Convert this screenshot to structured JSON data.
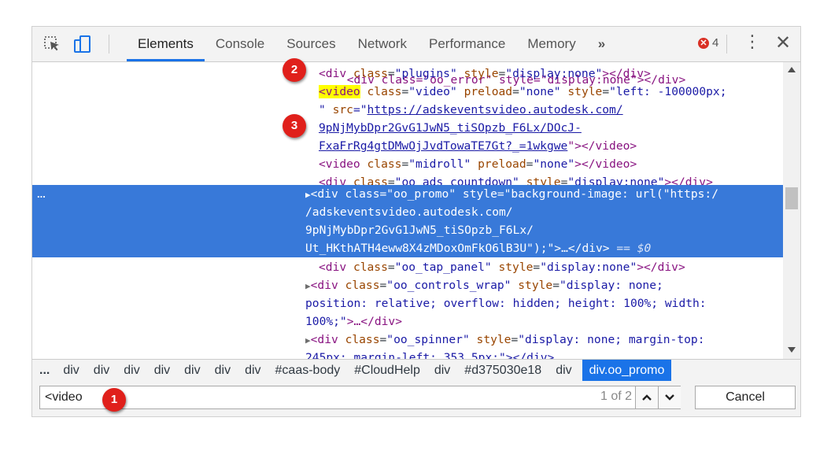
{
  "toolbar": {
    "tabs": [
      "Elements",
      "Console",
      "Sources",
      "Network",
      "Performance",
      "Memory"
    ],
    "more_icon": "»",
    "error_count": "4",
    "kebab": "⋮",
    "close": "✕"
  },
  "tree": {
    "l0": "<div class=\"oo_error\" style=\"display:none\"></div>",
    "l1_open": "<div ",
    "l1_attr": "class",
    "l1_val": "\"plugins\"",
    "l1_attr2": "style",
    "l1_val2": "\"display:none\"",
    "l1_close": "></div>",
    "l2_tag": "<video",
    "l2_rest_attr": "class",
    "l2_rest_val": "\"video\"",
    "l2_attr2": "preload",
    "l2_val2": "\"none\"",
    "l2_attr3": "style",
    "l2_val3": "\"left: -100000px;",
    "l3_q": "\"",
    "l3_attr": "src",
    "l3_eq": "=\"",
    "l3_link": "https://adskeventsvideo.autodesk.com/",
    "l4_link": "9pNjMybDpr2GvG1JwN5_tiSOpzb_F6Lx/DOcJ-",
    "l5_link": "FxaFrRg4gtDMwOjJvdTowaTE7Gt?_=1wkgwe",
    "l5_end": "\"></video>",
    "l6_attr": "class",
    "l6_val": "\"midroll\"",
    "l6_attr2": "preload",
    "l6_val2": "\"none\"",
    "l6_close": "></video>",
    "l7_attr": "class",
    "l7_val": "\"oo_ads_countdown\"",
    "l7_attr2": "style",
    "l7_val2": "\"display:none\"",
    "l7_close": "></div>",
    "sel_dots": "...",
    "sel1": "<div class=\"oo_promo\" style=\"background-image: url(\"https:/",
    "sel2": "/adskeventsvideo.autodesk.com/",
    "sel3": "9pNjMybDpr2GvG1JwN5_tiSOpzb_F6Lx/",
    "sel4": "Ut_HKthATH4eww8X4zMDoxOmFkO6lB3U\");\">…</div>",
    "sel4_eq": " == ",
    "sel4_dollar": "$0",
    "l8_attr": "class",
    "l8_val": "\"oo_tap_panel\"",
    "l8_attr2": "style",
    "l8_val2": "\"display:none\"",
    "l8_close": "></div>",
    "l9_attr": "class",
    "l9_val": "\"oo_controls_wrap\"",
    "l9_attr2": "style",
    "l9_val2": "\"display: none;",
    "l10": "position: relative; overflow: hidden; height: 100%; width:",
    "l11": "100%;\"",
    "l11_close": ">…</div>",
    "l12_attr": "class",
    "l12_val": "\"oo_spinner\"",
    "l12_attr2": "style",
    "l12_val2": "\"display: none; margin-top:",
    "l13": "245px; margin-left: 353.5px;\"></div>"
  },
  "breadcrumb": [
    "...",
    "div",
    "div",
    "div",
    "div",
    "div",
    "div",
    "div",
    "#caas-body",
    "#CloudHelp",
    "div",
    "#d375030e18",
    "div",
    "div.oo_promo"
  ],
  "search": {
    "value": "<video",
    "count": "1 of 2",
    "up": "▲",
    "down": "▼",
    "cancel": "Cancel"
  },
  "callouts": [
    "1",
    "2",
    "3"
  ],
  "colors": {
    "selection": "#3879d9",
    "highlight": "#ffff00",
    "callout": "#e0201b",
    "active_breadcrumb": "#1a73e8"
  }
}
